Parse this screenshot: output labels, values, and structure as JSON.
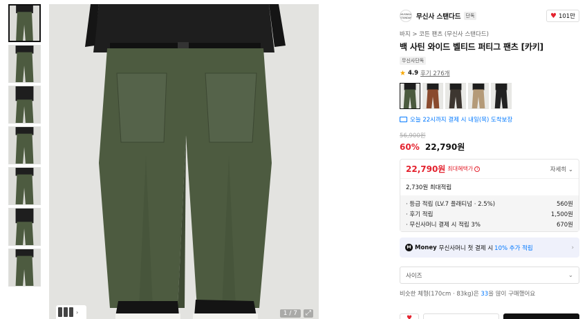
{
  "gallery": {
    "counter": "1 / 7",
    "thumbnail_count": 7
  },
  "brand": {
    "logo_text": "MUSINSA STANDARD",
    "name": "무신사 스탠다드",
    "badge": "단독",
    "likes": "101만"
  },
  "breadcrumb": {
    "items": [
      "바지",
      "코튼 팬츠 (무신사 스탠다드)"
    ],
    "separator": ">"
  },
  "product": {
    "title": "백 사틴 와이드 벨티드 퍼티그 팬츠 [카키]",
    "tag": "무신사단독",
    "rating": "4.9",
    "review_label": "후기 276개",
    "swatch_colors": [
      "#4b5a3e",
      "#8a4a2e",
      "#3d3630",
      "#b49a78",
      "#222222"
    ]
  },
  "delivery": {
    "text": "오늘 22시까지 결제 시 내일(목) 도착보장"
  },
  "price": {
    "original": "56,900원",
    "discount": "60%",
    "sale": "22,790원"
  },
  "benefit": {
    "price": "22,790원",
    "label": "최대혜택가",
    "detail_label": "자세히",
    "total_points": "2,730원 최대적립",
    "lines": [
      {
        "label": "· 등급 적립 (LV.7 플래티넘 · 2.5%)",
        "value": "560원"
      },
      {
        "label": "· 후기 적립",
        "value": "1,500원"
      },
      {
        "label": "· 무신사머니 결제 시 적립 3%",
        "value": "670원"
      }
    ]
  },
  "money_banner": {
    "logo": "M",
    "brand": "Money",
    "text": "무신사머니 첫 결제 시",
    "highlight": "10% 추가 적립"
  },
  "size_select": {
    "placeholder": "사이즈"
  },
  "fit": {
    "prefix": "비슷한 체형(170cm · 83kg)은",
    "highlight": "33",
    "suffix": "을 많이 구매했어요"
  }
}
